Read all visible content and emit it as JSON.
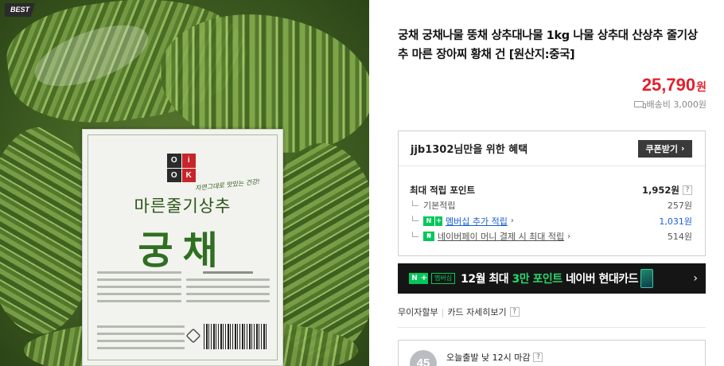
{
  "product_image": {
    "badge": "BEST",
    "logo_letters": [
      "O",
      "i",
      "O",
      "K"
    ],
    "slogan": "자연그대로 맛있는 건강!",
    "package_subname": "마른줄기상추",
    "package_name": "궁채"
  },
  "product": {
    "title": "궁채 궁채나물 뚱채 상추대나물 1kg 나물 상추대 산상추 줄기상추 마른 장아찌 황채 건 [원산지:중국]",
    "price": "25,790",
    "price_unit": "원",
    "shipping": "배송비 3,000원",
    "accent_color": "#e41f2d"
  },
  "benefit": {
    "title": "jjb1302님만을 위한 혜택",
    "coupon_button": "쿠폰받기",
    "max_points_label": "최대 적립 포인트",
    "max_points_value": "1,952원",
    "rows": [
      {
        "label": "기본적립",
        "value": "257원"
      },
      {
        "label": "멤버십 추가 적립",
        "value": "1,031원"
      },
      {
        "label": "네이버페이 머니 결제 시 최대 적립",
        "value": "514원"
      }
    ],
    "help": "?"
  },
  "banner": {
    "badge_n": "N",
    "badge_plus": "+",
    "badge_membership": "멤버십",
    "text_before": "12월 최대 ",
    "text_highlight": "3만 포인트",
    "text_after": " 네이버 현대카드",
    "highlight_color": "#2cd46a"
  },
  "payment": {
    "installment": "무이자할부",
    "card_details": "카드 자세히보기",
    "help": "?"
  },
  "delivery": {
    "logo_text": "45",
    "text": "오늘출발 낮 12시 마감",
    "help": "?"
  }
}
